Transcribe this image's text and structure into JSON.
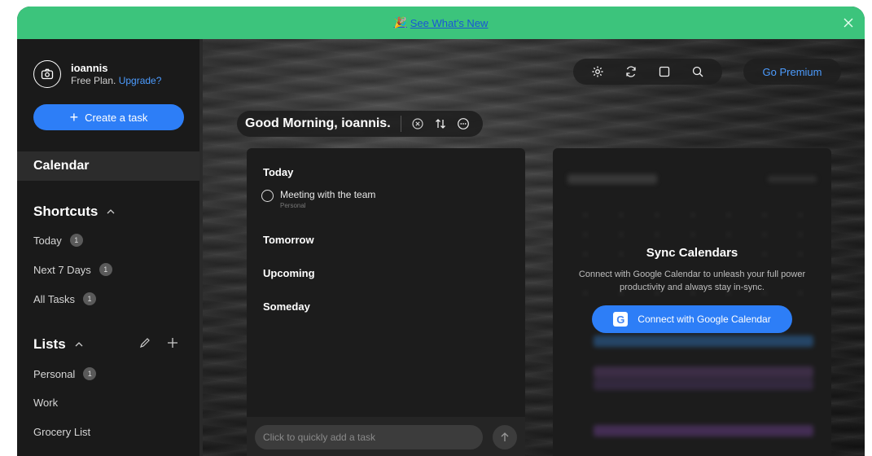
{
  "banner": {
    "emoji": "🎉",
    "link_text": "See What's New"
  },
  "profile": {
    "name": "ioannis",
    "plan": "Free Plan.",
    "upgrade": "Upgrade?"
  },
  "sidebar": {
    "create_task": "Create a task",
    "calendar": "Calendar",
    "shortcuts_title": "Shortcuts",
    "shortcuts": [
      {
        "label": "Today",
        "count": "1"
      },
      {
        "label": "Next 7 Days",
        "count": "1"
      },
      {
        "label": "All Tasks",
        "count": "1"
      }
    ],
    "lists_title": "Lists",
    "lists": [
      {
        "label": "Personal",
        "count": "1"
      },
      {
        "label": "Work"
      },
      {
        "label": "Grocery List"
      }
    ]
  },
  "toolbar": {
    "premium": "Go Premium"
  },
  "greeting": "Good Morning, ioannis.",
  "tasks": {
    "groups": [
      "Today",
      "Tomorrow",
      "Upcoming",
      "Someday"
    ],
    "today_task": {
      "title": "Meeting with the team",
      "list": "Personal"
    },
    "quick_add_placeholder": "Click to quickly add a task"
  },
  "calendar_panel": {
    "title": "Sync Calendars",
    "description": "Connect with Google Calendar to unleash your full power productivity and always stay in-sync.",
    "button": "Connect with Google Calendar",
    "google_letter": "G"
  },
  "colors": {
    "banner": "#3cc47c",
    "accent": "#2d7ef7",
    "link": "#4c9cff"
  }
}
